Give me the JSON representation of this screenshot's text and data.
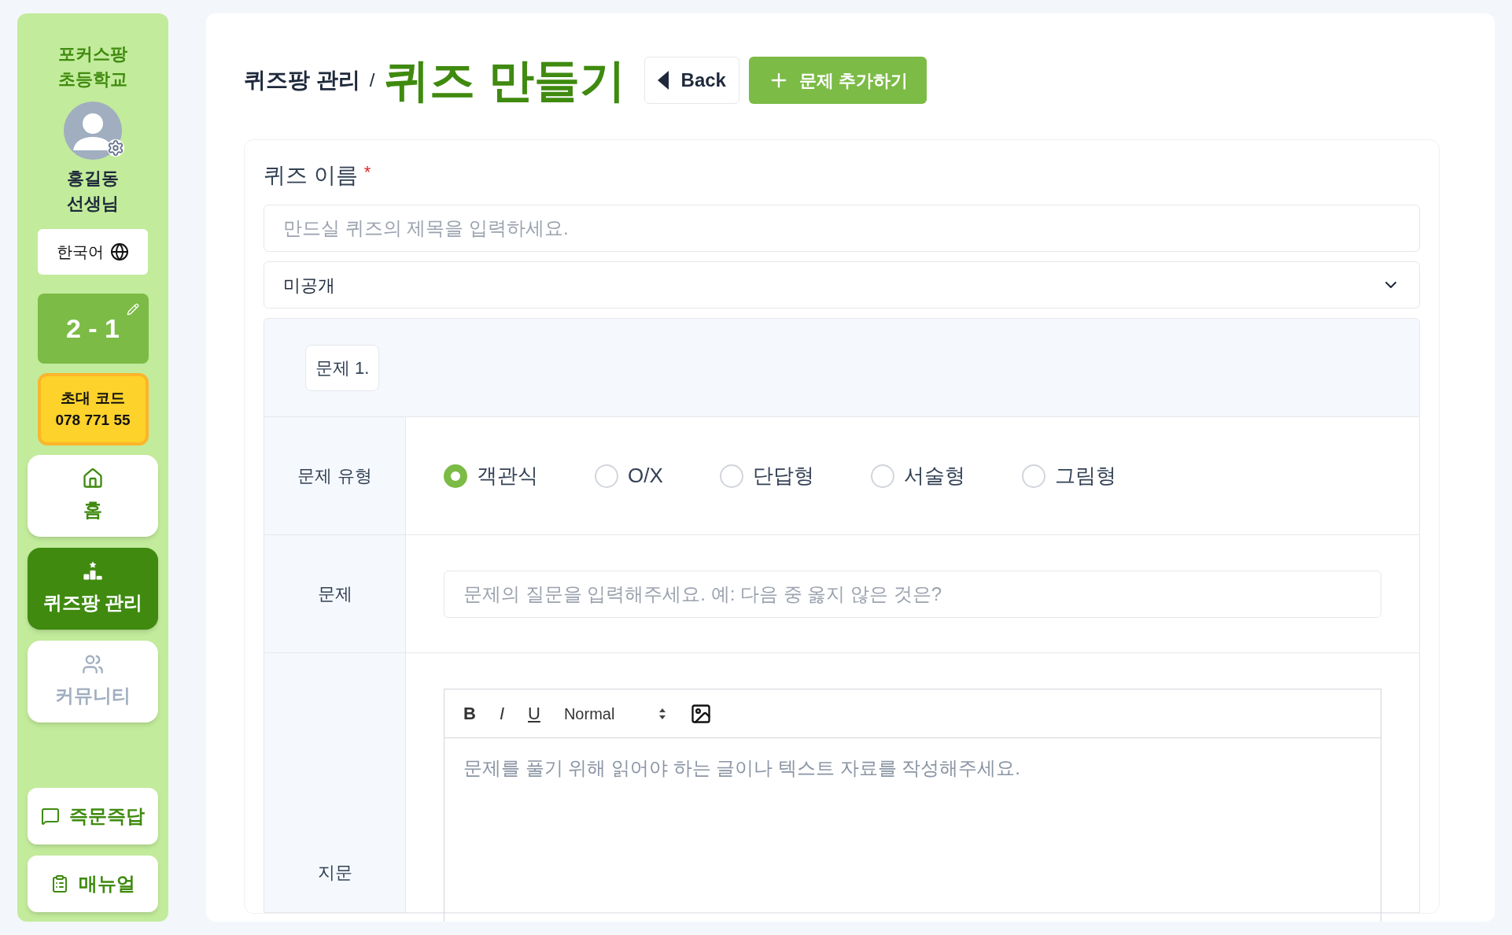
{
  "sidebar": {
    "school": "포커스팡\n초등학교",
    "teacher": "홍길동\n선생님",
    "language": "한국어",
    "class_label": "2 - 1",
    "invite": {
      "title": "초대 코드",
      "code": "078 771 55"
    },
    "nav": [
      {
        "label": "홈",
        "kind": "home",
        "selected": false,
        "disabled": false
      },
      {
        "label": "퀴즈팡 관리",
        "kind": "podium",
        "selected": true,
        "disabled": false
      },
      {
        "label": "커뮤니티",
        "kind": "people",
        "selected": false,
        "disabled": true
      }
    ],
    "bottom": [
      {
        "label": "즉문즉답",
        "kind": "chat"
      },
      {
        "label": "매뉴얼",
        "kind": "clipboard"
      }
    ]
  },
  "header": {
    "breadcrumb": "퀴즈팡 관리",
    "separator": "/",
    "title": "퀴즈 만들기",
    "back": "Back",
    "add": "문제 추가하기"
  },
  "form": {
    "name_label": "퀴즈 이름",
    "required": "*",
    "name_placeholder": "만드실 퀴즈의 제목을 입력하세요.",
    "visibility": "미공개",
    "question": {
      "number": "문제 1.",
      "type_label": "문제 유형",
      "types": [
        {
          "label": "객관식",
          "selected": true
        },
        {
          "label": "O/X",
          "selected": false
        },
        {
          "label": "단답형",
          "selected": false
        },
        {
          "label": "서술형",
          "selected": false
        },
        {
          "label": "그림형",
          "selected": false
        }
      ],
      "question_label": "문제",
      "question_placeholder": "문제의 질문을 입력해주세요. 예: 다음 중 옳지 않은 것은?",
      "passage_label": "지문",
      "toolbar": {
        "bold": "B",
        "italic": "I",
        "underline": "U",
        "format": "Normal"
      },
      "passage_placeholder": "문제를 풀기 위해 읽어야 하는 글이나 텍스트 자료를 작성해주세요."
    }
  }
}
